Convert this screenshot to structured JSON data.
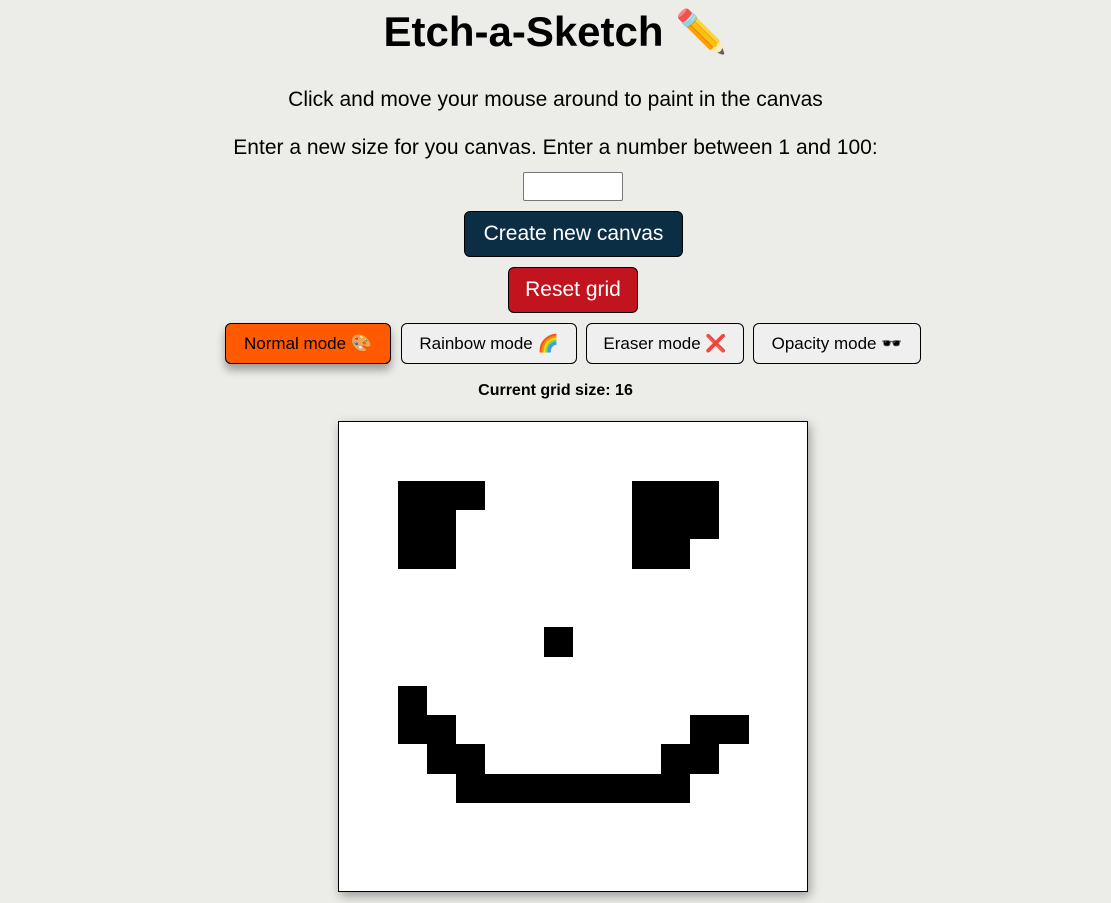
{
  "header": {
    "title": "Etch-a-Sketch",
    "title_emoji": "✏️"
  },
  "instructions": {
    "paint": "Click and move your mouse around to paint in the canvas",
    "size_prompt": "Enter a new size for you canvas. Enter a number between 1 and 100:"
  },
  "size_input": {
    "value": "",
    "placeholder": ""
  },
  "buttons": {
    "create": "Create new canvas",
    "reset": "Reset grid"
  },
  "modes": [
    {
      "label": "Normal mode 🎨",
      "active": true
    },
    {
      "label": "Rainbow mode 🌈",
      "active": false
    },
    {
      "label": "Eraser mode ❌",
      "active": false
    },
    {
      "label": "Opacity mode 🕶️",
      "active": false
    }
  ],
  "grid_size_text": "Current grid size: 16",
  "canvas": {
    "size": 16,
    "painted_cells": [
      [
        2,
        2
      ],
      [
        2,
        3
      ],
      [
        2,
        4
      ],
      [
        3,
        2
      ],
      [
        3,
        3
      ],
      [
        4,
        2
      ],
      [
        4,
        3
      ],
      [
        2,
        10
      ],
      [
        2,
        11
      ],
      [
        2,
        12
      ],
      [
        3,
        10
      ],
      [
        3,
        11
      ],
      [
        3,
        12
      ],
      [
        4,
        10
      ],
      [
        4,
        11
      ],
      [
        7,
        7
      ],
      [
        9,
        2
      ],
      [
        10,
        2
      ],
      [
        10,
        3
      ],
      [
        10,
        12
      ],
      [
        10,
        13
      ],
      [
        11,
        3
      ],
      [
        11,
        4
      ],
      [
        11,
        11
      ],
      [
        11,
        12
      ],
      [
        12,
        4
      ],
      [
        12,
        5
      ],
      [
        12,
        6
      ],
      [
        12,
        7
      ],
      [
        12,
        8
      ],
      [
        12,
        9
      ],
      [
        12,
        10
      ],
      [
        12,
        11
      ]
    ]
  },
  "colors": {
    "background": "#ecece8",
    "create_button": "#0b2e45",
    "reset_button": "#c2141f",
    "active_mode": "#ff5a00",
    "paint": "#000000"
  }
}
